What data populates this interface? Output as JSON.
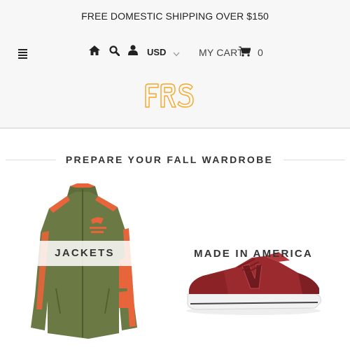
{
  "promo": {
    "text": "FREE DOMESTIC SHIPPING OVER $150"
  },
  "nav": {
    "currency": "USD",
    "cart_label": "MY CART",
    "cart_count": "0"
  },
  "logo": {
    "text": "FRS",
    "color": "#f5a623"
  },
  "section": {
    "title": "PREPARE YOUR FALL WARDROBE"
  },
  "tiles": [
    {
      "label": "JACKETS",
      "image": "olive-orange-track-jacket"
    },
    {
      "label": "MADE IN AMERICA",
      "image": "burgundy-sneaker"
    }
  ],
  "colors": {
    "header_bg": "#f7f7f7",
    "text": "#333333",
    "accent": "#f5a623"
  }
}
